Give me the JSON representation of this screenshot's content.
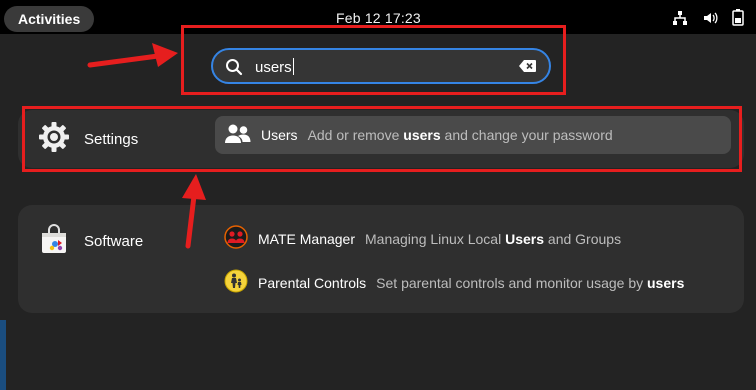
{
  "topbar": {
    "activities_label": "Activities",
    "clock": "Feb 12  17:23",
    "tray_icons": [
      "network-icon",
      "volume-icon",
      "battery-icon"
    ]
  },
  "search": {
    "value": "users",
    "icon": "search-icon",
    "clear_icon": "clear-icon"
  },
  "providers": [
    {
      "name": "Settings",
      "icon": "settings-gear-icon",
      "results": [
        {
          "name": "Users",
          "icon": "users-icon",
          "desc_before": "Add or remove ",
          "desc_bold": "users",
          "desc_after": " and change your password",
          "selected": true
        }
      ]
    },
    {
      "name": "Software",
      "icon": "software-bag-icon",
      "results": [
        {
          "name": "MATE Manager",
          "icon": "mate-manager-icon",
          "desc_before": "Managing Linux Local ",
          "desc_bold": "Users",
          "desc_after": " and Groups"
        },
        {
          "name": "Parental Controls",
          "icon": "parental-controls-icon",
          "desc_before": "Set parental controls and monitor usage by ",
          "desc_bold": "users",
          "desc_after": ""
        }
      ]
    }
  ],
  "colors": {
    "topbar": "#000000",
    "background": "#232323",
    "panel": "#2f2f2f",
    "selected_row": "#4a4a4a",
    "focus_ring": "#3584e4",
    "annotation": "#e61e1e"
  }
}
